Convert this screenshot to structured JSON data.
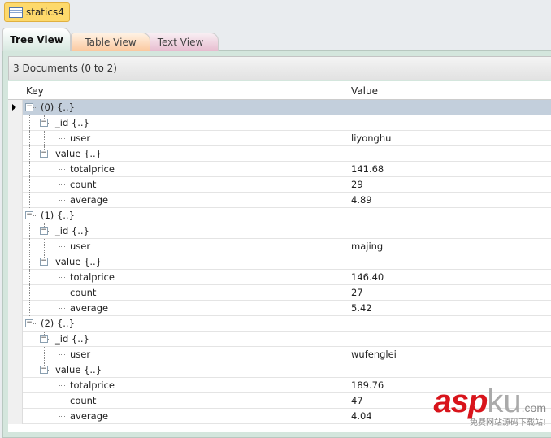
{
  "document_tab": {
    "label": "statics4",
    "icon": "table-icon"
  },
  "tabs": [
    {
      "label": "Tree View",
      "active": true
    },
    {
      "label": "Table View"
    },
    {
      "label": "Text View"
    }
  ],
  "status": "3 Documents (0 to 2)",
  "columns": {
    "key": "Key",
    "value": "Value"
  },
  "rows": [
    {
      "depth": 0,
      "key": "(0) {..}",
      "value": "",
      "toggle": "-",
      "selected": true
    },
    {
      "depth": 1,
      "key": "_id {..}",
      "value": "",
      "toggle": "-"
    },
    {
      "depth": 2,
      "key": "user",
      "value": "liyonghu"
    },
    {
      "depth": 1,
      "key": "value {..}",
      "value": "",
      "toggle": "-"
    },
    {
      "depth": 2,
      "key": "totalprice",
      "value": "141.68"
    },
    {
      "depth": 2,
      "key": "count",
      "value": "29"
    },
    {
      "depth": 2,
      "key": "average",
      "value": "4.89"
    },
    {
      "depth": 0,
      "key": "(1) {..}",
      "value": "",
      "toggle": "-"
    },
    {
      "depth": 1,
      "key": "_id {..}",
      "value": "",
      "toggle": "-"
    },
    {
      "depth": 2,
      "key": "user",
      "value": "majing"
    },
    {
      "depth": 1,
      "key": "value {..}",
      "value": "",
      "toggle": "-"
    },
    {
      "depth": 2,
      "key": "totalprice",
      "value": "146.40"
    },
    {
      "depth": 2,
      "key": "count",
      "value": "27"
    },
    {
      "depth": 2,
      "key": "average",
      "value": "5.42"
    },
    {
      "depth": 0,
      "key": "(2) {..}",
      "value": "",
      "toggle": "-"
    },
    {
      "depth": 1,
      "key": "_id {..}",
      "value": "",
      "toggle": "-"
    },
    {
      "depth": 2,
      "key": "user",
      "value": "wufenglei"
    },
    {
      "depth": 1,
      "key": "value {..}",
      "value": "",
      "toggle": "-"
    },
    {
      "depth": 2,
      "key": "totalprice",
      "value": "189.76"
    },
    {
      "depth": 2,
      "key": "count",
      "value": "47"
    },
    {
      "depth": 2,
      "key": "average",
      "value": "4.04"
    }
  ],
  "watermark": {
    "brand": "asp",
    "brand2": "ku",
    "domain": ".com",
    "slogan": "免费网站源码下载站!"
  }
}
